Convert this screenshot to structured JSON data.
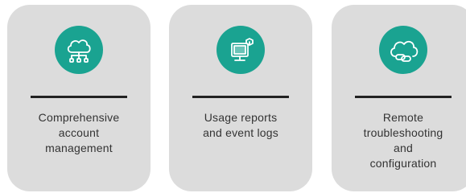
{
  "colors": {
    "card_background": "#dcdcdc",
    "icon_circle": "#1aa391",
    "divider": "#222222",
    "text": "#333333"
  },
  "cards": [
    {
      "icon": "cloud-network-icon",
      "label": "Comprehensive\naccount\nmanagement"
    },
    {
      "icon": "computer-monitor-icon",
      "label": "Usage reports\nand event logs"
    },
    {
      "icon": "cloud-link-icon",
      "label": "Remote\ntroubleshooting\nand\nconfiguration"
    }
  ]
}
